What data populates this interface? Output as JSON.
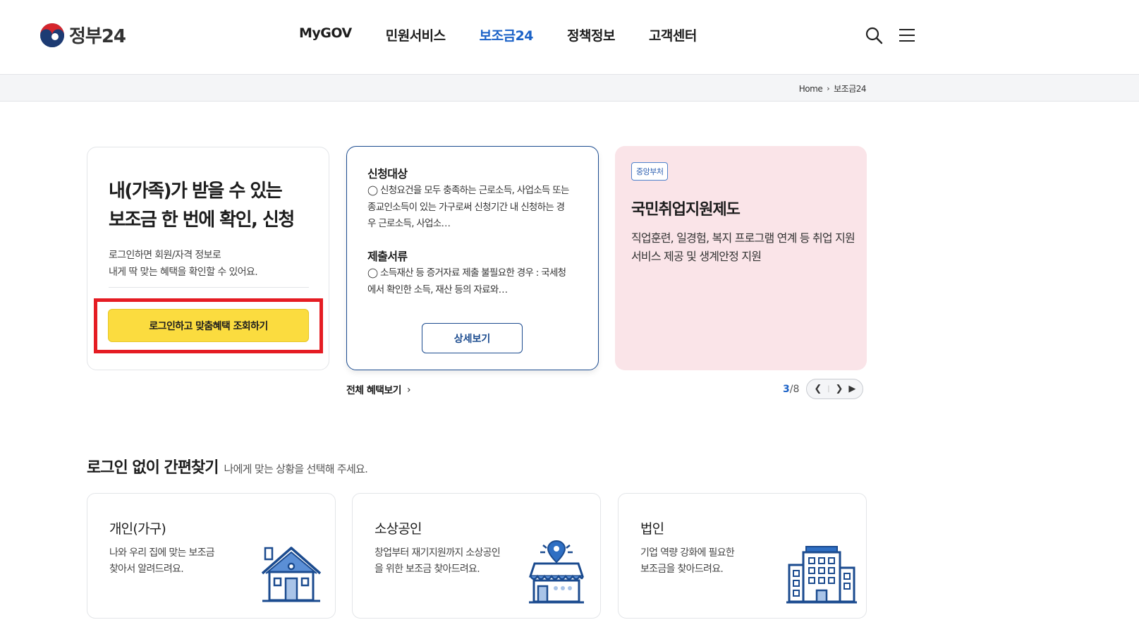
{
  "header": {
    "logo_text": "정부24",
    "nav": [
      "MyGOV",
      "민원서비스",
      "보조금24",
      "정책정보",
      "고객센터"
    ],
    "active_nav": "보조금24",
    "icons": [
      "search-icon",
      "menu-icon"
    ]
  },
  "breadcrumb": {
    "home": "Home",
    "current": "보조금24"
  },
  "login_card": {
    "title_line1": "내(가족)가 받을 수 있는",
    "title_line2": "보조금 한 번에 확인, 신청",
    "desc_line1": "로그인하면 회원/자격 정보로",
    "desc_line2": "내게 딱 맞는 혜택을 확인할 수 있어요.",
    "button": "로그인하고 맞춤혜택 조회하기",
    "highlight_color": "#e51c23"
  },
  "detail_card": {
    "target_heading": "신청대상",
    "target_text": "◯ 신청요건을 모두 충족하는 근로소득, 사업소득 또는 종교인소득이 있는 가구로써 신청기간 내 신청하는 경우 근로소득, 사업소…",
    "docs_heading": "제출서류",
    "docs_text": "◯ 소득재산 등 증거자료 제출 불필요한 경우 : 국세청에서 확인한 소득, 재산 등의 자료와…",
    "button": "상세보기"
  },
  "pink_card": {
    "tag": "중앙부처",
    "title": "국민취업지원제도",
    "desc": "직업훈련, 일경험, 복지 프로그램 연계 등 취업 지원서비스 제공 및 생계안정 지원"
  },
  "all_benefits": "전체 혜택보기",
  "pager": {
    "current": "3",
    "slash": "/",
    "total": "8"
  },
  "quick_find": {
    "title": "로그인 없이 간편찾기",
    "subtitle": "나에게 맞는 상황을 선택해 주세요.",
    "cards": [
      {
        "title": "개인(가구)",
        "desc_line1": "나와 우리 집에 맞는 보조금",
        "desc_line2": "찾아서 알려드려요.",
        "icon": "house-icon"
      },
      {
        "title": "소상공인",
        "desc_line1": "창업부터 재기지원까지 소상공인",
        "desc_line2": "을 위한 보조금 찾아드려요.",
        "icon": "shop-icon"
      },
      {
        "title": "법인",
        "desc_line1": "기업 역량 강화에 필요한",
        "desc_line2": "보조금을 찾아드려요.",
        "icon": "building-icon"
      }
    ]
  },
  "colors": {
    "accent": "#1b62c7",
    "navy": "#1b4b8f",
    "yellow": "#fbdc3f",
    "pink": "#fae4e8"
  }
}
